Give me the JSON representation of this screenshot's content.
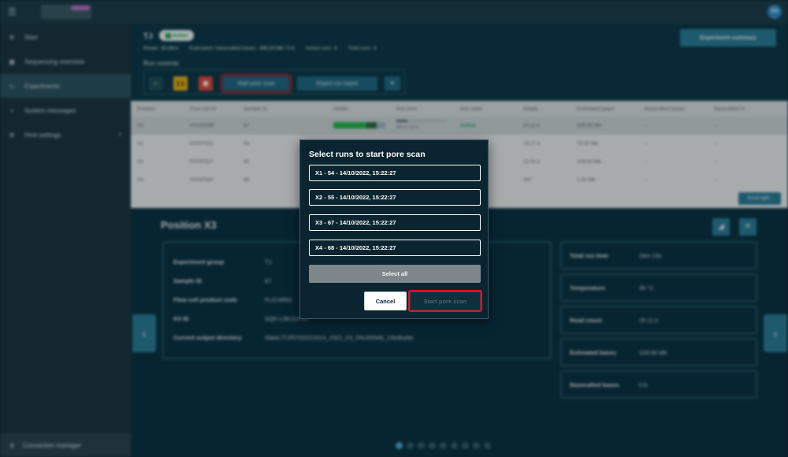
{
  "topbar": {
    "menu_icon": "☰",
    "avatar": "SO"
  },
  "sidebar": {
    "items": [
      {
        "label": "Start",
        "icon": "⚙"
      },
      {
        "label": "Sequencing overview",
        "icon": "▦"
      },
      {
        "label": "Experiments",
        "icon": "∿"
      },
      {
        "label": "System messages",
        "icon": "▪"
      },
      {
        "label": "Host settings",
        "icon": "⚙"
      }
    ],
    "chevron": "›",
    "connection_manager": {
      "label": "Connection manager",
      "icon": "⋔"
    }
  },
  "experiment": {
    "name": "TJ",
    "status": "Active",
    "stats": {
      "reads_label": "Reads",
      "reads": "60.68 k",
      "bases_label": "Estimated / basecalled bases",
      "bases": "286.33 Mb / 0 b",
      "active_runs_label": "Active runs",
      "active_runs": "4",
      "total_runs_label": "Total runs",
      "total_runs": "4"
    },
    "run_controls_label": "Run controls",
    "start_pore_scan": "Start pore scan",
    "export_run_report": "Export run report",
    "experiment_summary": "Experiment summary"
  },
  "table": {
    "headers": [
      "Position",
      "Flow cell ID",
      "Sample ID",
      "Health",
      "Run time",
      "Run state",
      "Reads",
      "Estimated bases",
      "Basecalled bases",
      "Basecalled %"
    ],
    "rows": [
      {
        "position": "X3",
        "flow_cell": "FAU00546",
        "sample": "67",
        "run_time": "28 m / 12 h",
        "state": "Active",
        "reads": "20.11 k",
        "est_bases": "109.96 Mb",
        "bc_bases": "--",
        "bc_pct": "--"
      },
      {
        "position": "X1",
        "flow_cell": "FAT97523",
        "sample": "54",
        "run_time": "",
        "state": "",
        "reads": "19.17 k",
        "est_bases": "70.32 Mb",
        "bc_bases": "--",
        "bc_pct": "--"
      },
      {
        "position": "X2",
        "flow_cell": "FAT97517",
        "sample": "55",
        "run_time": "",
        "state": "",
        "reads": "21.01 k",
        "est_bases": "106.63 Mb",
        "bc_bases": "--",
        "bc_pct": "--"
      },
      {
        "position": "X4",
        "flow_cell": "FAT97530",
        "sample": "68",
        "run_time": "",
        "state": "",
        "reads": "397",
        "est_bases": "1.42 Mb",
        "bc_bases": "--",
        "bc_pct": "--"
      }
    ],
    "scroll_right": "Scroll right ›"
  },
  "detail": {
    "title": "Position X3",
    "info": [
      {
        "key": "Experiment group",
        "value": "TJ"
      },
      {
        "key": "Sample ID",
        "value": "67"
      },
      {
        "key": "Flow cell product code",
        "value": "FLO-MIN1"
      },
      {
        "key": "Kit ID",
        "value": "SQK-LSK114-XL"
      },
      {
        "key": "Current output directory",
        "value": "/data/./TJ/67/20221014_1522_X3_FAU00546_23edea9e"
      }
    ],
    "stats": [
      {
        "key": "Total run time",
        "value": "28m 15s"
      },
      {
        "key": "Temperature",
        "value": "35 °C"
      },
      {
        "key": "Read count",
        "value": "20.11 k"
      },
      {
        "key": "Estimated bases",
        "value": "109.96 Mb"
      },
      {
        "key": "Basecalled bases",
        "value": "0 b"
      }
    ],
    "page_count": 9
  },
  "modal": {
    "title": "Select runs to start pore scan",
    "runs": [
      "X1 - 54 - 14/10/2022, 15:22:27",
      "X2 - 55 - 14/10/2022, 15:22:27",
      "X3 - 67 - 14/10/2022, 15:22:27",
      "X4 - 68 - 14/10/2022, 15:22:27"
    ],
    "select_all": "Select all",
    "cancel": "Cancel",
    "start": "Start pore scan"
  }
}
